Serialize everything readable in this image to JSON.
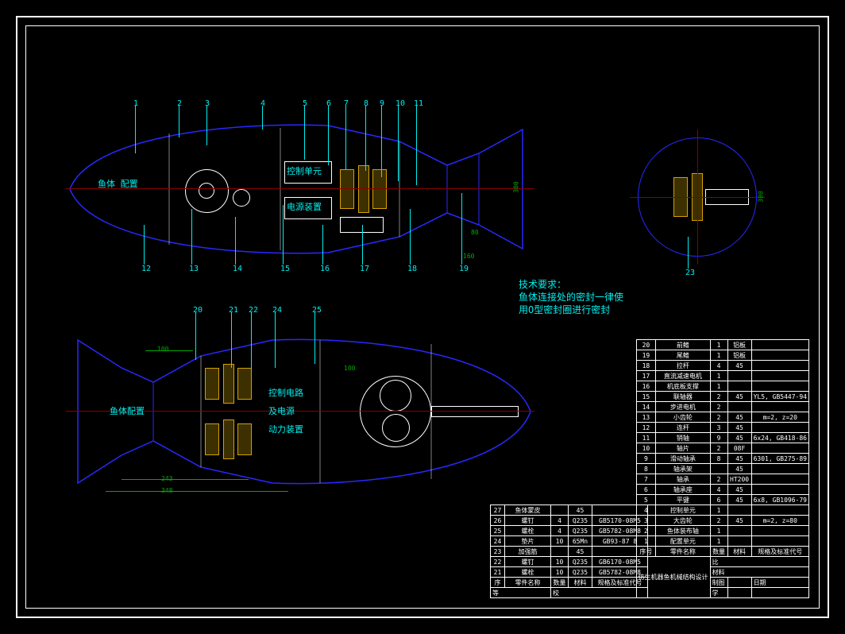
{
  "requirements": {
    "title": "技术要求：",
    "line1": "鱼体连接处的密封一律使",
    "line2": "用O型密封圈进行密封"
  },
  "annotations": {
    "top": {
      "body_config": "鱼体\n配置",
      "ctrl_unit": "控制单元",
      "power_unit": "电源装置"
    },
    "bottom": {
      "body_config": "鱼体配置",
      "ctrl_circuit": "控制电路",
      "and_power": "及电源",
      "drive_unit": "动力装置"
    }
  },
  "callouts_top": [
    "1",
    "2",
    "3",
    "4",
    "5",
    "6",
    "7",
    "8",
    "9",
    "10",
    "11",
    "12",
    "13",
    "14",
    "15",
    "16",
    "17",
    "18",
    "19"
  ],
  "callouts_bottom": [
    "20",
    "21",
    "22",
    "24",
    "25"
  ],
  "callout_side": "23",
  "dims": {
    "d100": "100",
    "d80": "80",
    "d160": "160",
    "d243": "243",
    "d348": "348",
    "d300a": "300",
    "d300b": "300"
  },
  "bom_right": [
    {
      "no": "20",
      "name": "前鳍",
      "qty": "1",
      "mat": "铝板",
      "std": ""
    },
    {
      "no": "19",
      "name": "尾鳍",
      "qty": "1",
      "mat": "铝板",
      "std": ""
    },
    {
      "no": "18",
      "name": "拉杆",
      "qty": "4",
      "mat": "45",
      "std": ""
    },
    {
      "no": "17",
      "name": "直流减速电机",
      "qty": "1",
      "mat": "",
      "std": ""
    },
    {
      "no": "16",
      "name": "机底板支撑",
      "qty": "1",
      "mat": "",
      "std": ""
    },
    {
      "no": "15",
      "name": "联轴器",
      "qty": "2",
      "mat": "45",
      "std": "YL5, GB5447-94"
    },
    {
      "no": "14",
      "name": "步进电机",
      "qty": "2",
      "mat": "",
      "std": ""
    },
    {
      "no": "13",
      "name": "小齿轮",
      "qty": "2",
      "mat": "45",
      "std": "m=2, z=20"
    },
    {
      "no": "12",
      "name": "连杆",
      "qty": "3",
      "mat": "45",
      "std": ""
    },
    {
      "no": "11",
      "name": "销轴",
      "qty": "9",
      "mat": "45",
      "std": "6x24, GB418-86"
    },
    {
      "no": "10",
      "name": "轴片",
      "qty": "2",
      "mat": "08F",
      "std": ""
    },
    {
      "no": "9",
      "name": "滑动轴承",
      "qty": "8",
      "mat": "45",
      "std": "6301, GB275-89"
    },
    {
      "no": "8",
      "name": "轴承架",
      "qty": "",
      "mat": "45",
      "std": ""
    },
    {
      "no": "7",
      "name": "轴承",
      "qty": "2",
      "mat": "HT200",
      "std": ""
    },
    {
      "no": "6",
      "name": "轴承座",
      "qty": "4",
      "mat": "45",
      "std": ""
    },
    {
      "no": "5",
      "name": "平键",
      "qty": "6",
      "mat": "45",
      "std": "6x8, GB1096-79"
    },
    {
      "no": "4",
      "name": "控制单元",
      "qty": "1",
      "mat": "",
      "std": ""
    },
    {
      "no": "3",
      "name": "大齿轮",
      "qty": "2",
      "mat": "45",
      "std": "m=2, z=80"
    },
    {
      "no": "2",
      "name": "鱼体装布轴",
      "qty": "1",
      "mat": "",
      "std": ""
    },
    {
      "no": "1",
      "name": "配置单元",
      "qty": "1",
      "mat": "",
      "std": ""
    }
  ],
  "bom_right_header": {
    "no": "序号",
    "name": "零件名称",
    "qty": "数量",
    "mat": "材料",
    "std": "规格及标准代号"
  },
  "bom_left": [
    {
      "no": "27",
      "name": "鱼体蒙皮",
      "qty": "",
      "mat": "45",
      "std": ""
    },
    {
      "no": "26",
      "name": "螺钉",
      "qty": "4",
      "mat": "Q235",
      "std": "GB5170-08M5"
    },
    {
      "no": "25",
      "name": "螺栓",
      "qty": "4",
      "mat": "Q235",
      "std": "GB5782-08M8"
    },
    {
      "no": "24",
      "name": "垫片",
      "qty": "10",
      "mat": "65Mn",
      "std": "GB93-87 8"
    },
    {
      "no": "23",
      "name": "加强筋",
      "qty": "",
      "mat": "45",
      "std": ""
    },
    {
      "no": "22",
      "name": "螺钉",
      "qty": "10",
      "mat": "Q235",
      "std": "GB6170-08M5"
    },
    {
      "no": "21",
      "name": "螺栓",
      "qty": "10",
      "mat": "Q235",
      "std": "GB5782-08M8"
    }
  ],
  "bom_left_header": {
    "no": "序",
    "name": "零件名称",
    "qty": "数量",
    "mat": "材料",
    "std": "规格及标准代号"
  },
  "title_block": {
    "project": "仿生机器鱼机械结构设计",
    "scale_label": "比",
    "drawn_label": "制图",
    "date_label": "日期",
    "school_label": "学",
    "dept_label": "等",
    "check_label": "校",
    "mat_label": "材料"
  }
}
